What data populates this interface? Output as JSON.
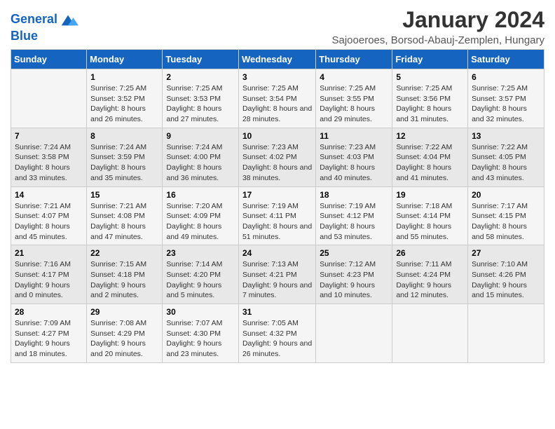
{
  "logo": {
    "line1": "General",
    "line2": "Blue"
  },
  "title": "January 2024",
  "subtitle": "Sajooeroes, Borsod-Abauj-Zemplen, Hungary",
  "days_of_week": [
    "Sunday",
    "Monday",
    "Tuesday",
    "Wednesday",
    "Thursday",
    "Friday",
    "Saturday"
  ],
  "weeks": [
    [
      {
        "day": "",
        "sunrise": "",
        "sunset": "",
        "daylight": ""
      },
      {
        "day": "1",
        "sunrise": "Sunrise: 7:25 AM",
        "sunset": "Sunset: 3:52 PM",
        "daylight": "Daylight: 8 hours and 26 minutes."
      },
      {
        "day": "2",
        "sunrise": "Sunrise: 7:25 AM",
        "sunset": "Sunset: 3:53 PM",
        "daylight": "Daylight: 8 hours and 27 minutes."
      },
      {
        "day": "3",
        "sunrise": "Sunrise: 7:25 AM",
        "sunset": "Sunset: 3:54 PM",
        "daylight": "Daylight: 8 hours and 28 minutes."
      },
      {
        "day": "4",
        "sunrise": "Sunrise: 7:25 AM",
        "sunset": "Sunset: 3:55 PM",
        "daylight": "Daylight: 8 hours and 29 minutes."
      },
      {
        "day": "5",
        "sunrise": "Sunrise: 7:25 AM",
        "sunset": "Sunset: 3:56 PM",
        "daylight": "Daylight: 8 hours and 31 minutes."
      },
      {
        "day": "6",
        "sunrise": "Sunrise: 7:25 AM",
        "sunset": "Sunset: 3:57 PM",
        "daylight": "Daylight: 8 hours and 32 minutes."
      }
    ],
    [
      {
        "day": "7",
        "sunrise": "Sunrise: 7:24 AM",
        "sunset": "Sunset: 3:58 PM",
        "daylight": "Daylight: 8 hours and 33 minutes."
      },
      {
        "day": "8",
        "sunrise": "Sunrise: 7:24 AM",
        "sunset": "Sunset: 3:59 PM",
        "daylight": "Daylight: 8 hours and 35 minutes."
      },
      {
        "day": "9",
        "sunrise": "Sunrise: 7:24 AM",
        "sunset": "Sunset: 4:00 PM",
        "daylight": "Daylight: 8 hours and 36 minutes."
      },
      {
        "day": "10",
        "sunrise": "Sunrise: 7:23 AM",
        "sunset": "Sunset: 4:02 PM",
        "daylight": "Daylight: 8 hours and 38 minutes."
      },
      {
        "day": "11",
        "sunrise": "Sunrise: 7:23 AM",
        "sunset": "Sunset: 4:03 PM",
        "daylight": "Daylight: 8 hours and 40 minutes."
      },
      {
        "day": "12",
        "sunrise": "Sunrise: 7:22 AM",
        "sunset": "Sunset: 4:04 PM",
        "daylight": "Daylight: 8 hours and 41 minutes."
      },
      {
        "day": "13",
        "sunrise": "Sunrise: 7:22 AM",
        "sunset": "Sunset: 4:05 PM",
        "daylight": "Daylight: 8 hours and 43 minutes."
      }
    ],
    [
      {
        "day": "14",
        "sunrise": "Sunrise: 7:21 AM",
        "sunset": "Sunset: 4:07 PM",
        "daylight": "Daylight: 8 hours and 45 minutes."
      },
      {
        "day": "15",
        "sunrise": "Sunrise: 7:21 AM",
        "sunset": "Sunset: 4:08 PM",
        "daylight": "Daylight: 8 hours and 47 minutes."
      },
      {
        "day": "16",
        "sunrise": "Sunrise: 7:20 AM",
        "sunset": "Sunset: 4:09 PM",
        "daylight": "Daylight: 8 hours and 49 minutes."
      },
      {
        "day": "17",
        "sunrise": "Sunrise: 7:19 AM",
        "sunset": "Sunset: 4:11 PM",
        "daylight": "Daylight: 8 hours and 51 minutes."
      },
      {
        "day": "18",
        "sunrise": "Sunrise: 7:19 AM",
        "sunset": "Sunset: 4:12 PM",
        "daylight": "Daylight: 8 hours and 53 minutes."
      },
      {
        "day": "19",
        "sunrise": "Sunrise: 7:18 AM",
        "sunset": "Sunset: 4:14 PM",
        "daylight": "Daylight: 8 hours and 55 minutes."
      },
      {
        "day": "20",
        "sunrise": "Sunrise: 7:17 AM",
        "sunset": "Sunset: 4:15 PM",
        "daylight": "Daylight: 8 hours and 58 minutes."
      }
    ],
    [
      {
        "day": "21",
        "sunrise": "Sunrise: 7:16 AM",
        "sunset": "Sunset: 4:17 PM",
        "daylight": "Daylight: 9 hours and 0 minutes."
      },
      {
        "day": "22",
        "sunrise": "Sunrise: 7:15 AM",
        "sunset": "Sunset: 4:18 PM",
        "daylight": "Daylight: 9 hours and 2 minutes."
      },
      {
        "day": "23",
        "sunrise": "Sunrise: 7:14 AM",
        "sunset": "Sunset: 4:20 PM",
        "daylight": "Daylight: 9 hours and 5 minutes."
      },
      {
        "day": "24",
        "sunrise": "Sunrise: 7:13 AM",
        "sunset": "Sunset: 4:21 PM",
        "daylight": "Daylight: 9 hours and 7 minutes."
      },
      {
        "day": "25",
        "sunrise": "Sunrise: 7:12 AM",
        "sunset": "Sunset: 4:23 PM",
        "daylight": "Daylight: 9 hours and 10 minutes."
      },
      {
        "day": "26",
        "sunrise": "Sunrise: 7:11 AM",
        "sunset": "Sunset: 4:24 PM",
        "daylight": "Daylight: 9 hours and 12 minutes."
      },
      {
        "day": "27",
        "sunrise": "Sunrise: 7:10 AM",
        "sunset": "Sunset: 4:26 PM",
        "daylight": "Daylight: 9 hours and 15 minutes."
      }
    ],
    [
      {
        "day": "28",
        "sunrise": "Sunrise: 7:09 AM",
        "sunset": "Sunset: 4:27 PM",
        "daylight": "Daylight: 9 hours and 18 minutes."
      },
      {
        "day": "29",
        "sunrise": "Sunrise: 7:08 AM",
        "sunset": "Sunset: 4:29 PM",
        "daylight": "Daylight: 9 hours and 20 minutes."
      },
      {
        "day": "30",
        "sunrise": "Sunrise: 7:07 AM",
        "sunset": "Sunset: 4:30 PM",
        "daylight": "Daylight: 9 hours and 23 minutes."
      },
      {
        "day": "31",
        "sunrise": "Sunrise: 7:05 AM",
        "sunset": "Sunset: 4:32 PM",
        "daylight": "Daylight: 9 hours and 26 minutes."
      },
      {
        "day": "",
        "sunrise": "",
        "sunset": "",
        "daylight": ""
      },
      {
        "day": "",
        "sunrise": "",
        "sunset": "",
        "daylight": ""
      },
      {
        "day": "",
        "sunrise": "",
        "sunset": "",
        "daylight": ""
      }
    ]
  ]
}
